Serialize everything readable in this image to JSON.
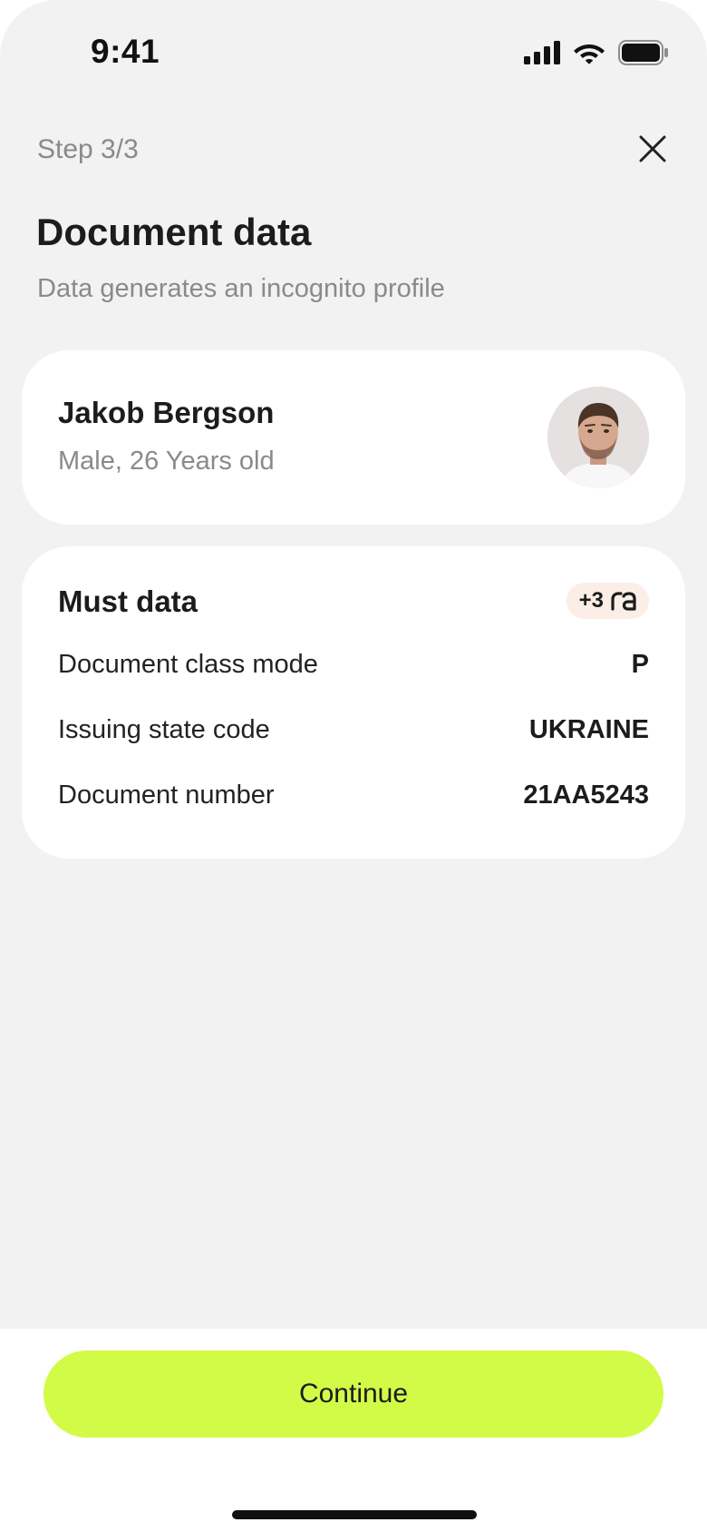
{
  "status_bar": {
    "time": "9:41",
    "icons": [
      "signal-icon",
      "wifi-icon",
      "battery-icon"
    ]
  },
  "header": {
    "step": "Step 3/3",
    "close_icon": "close-icon",
    "title": "Document data",
    "subtitle": "Data generates an incognito profile"
  },
  "profile": {
    "name": "Jakob Bergson",
    "meta": "Male, 26 Years old",
    "avatar_icon": "avatar-photo"
  },
  "must_data": {
    "title": "Must data",
    "reward": {
      "count": "+3",
      "logo_icon": "ra-logo-icon"
    },
    "rows": [
      {
        "label": "Document class mode",
        "value": "P"
      },
      {
        "label": "Issuing state code",
        "value": "UKRAINE"
      },
      {
        "label": "Document number",
        "value": "21AA5243"
      }
    ]
  },
  "footer": {
    "continue_label": "Continue"
  },
  "colors": {
    "background": "#f2f2f2",
    "card": "#ffffff",
    "accent": "#d2fb48",
    "badge": "#fbeee6",
    "muted_text": "#8a8a8a"
  }
}
